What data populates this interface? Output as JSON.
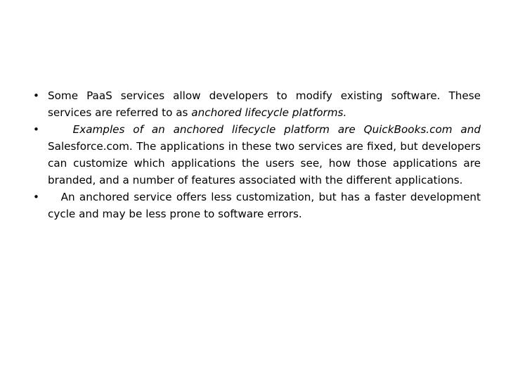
{
  "slide": {
    "background_color": "#ffffff",
    "text_color": "#000000",
    "bullet_glyph": "•",
    "bullets": [
      {
        "id": "bullet-1",
        "leading_space": false,
        "runs": [
          {
            "text": "Some PaaS services allow developers to modify existing software. These services are referred to as ",
            "italic": false
          },
          {
            "text": "anchored lifecycle platforms.",
            "italic": true
          }
        ],
        "plain_text": "Some PaaS services allow developers to modify existing software. These services are referred to as anchored lifecycle platforms."
      },
      {
        "id": "bullet-2",
        "leading_space": true,
        "runs": [
          {
            "text": "Examples of an anchored lifecycle platform are QuickBooks.com and",
            "italic": true
          },
          {
            "text": " Salesforce.com. The applications in these two services are fixed, but developers can customize which applications the users see, how those applications are branded, and a number of features associated with the different applications.",
            "italic": false
          }
        ],
        "plain_text": "Examples of an anchored lifecycle platform are QuickBooks.com and Salesforce.com. The applications in these two services are fixed, but developers can customize which applications the users see, how those applications are branded, and a number of features associated with the different applications."
      },
      {
        "id": "bullet-3",
        "leading_space": true,
        "runs": [
          {
            "text": "An anchored service offers less customization, but has a faster development cycle and may be less prone to software errors.",
            "italic": false
          }
        ],
        "plain_text": "An anchored service offers less customization, but has a faster development cycle and may be less prone to software errors."
      }
    ]
  }
}
